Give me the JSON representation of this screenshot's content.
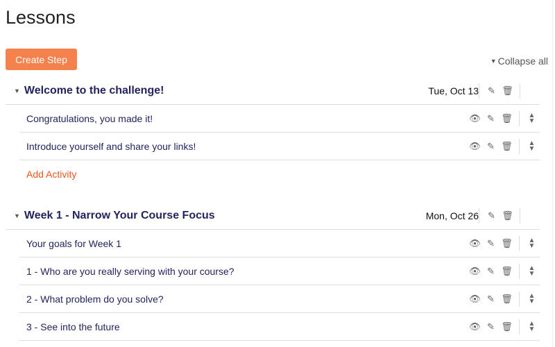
{
  "page": {
    "title": "Lessons",
    "create_label": "Create Step",
    "collapse_label": "Collapse all"
  },
  "sections": [
    {
      "title": "Welcome to the challenge!",
      "date": "Tue, Oct 13",
      "items": [
        "Congratulations, you made it!",
        "Introduce yourself and share your links!"
      ],
      "add_label": "Add Activity"
    },
    {
      "title": "Week 1 - Narrow Your Course Focus",
      "date": "Mon, Oct 26",
      "items": [
        "Your goals for Week 1",
        "1 - Who are you really serving with your course?",
        "2 - What problem do you solve?",
        "3 - See into the future"
      ]
    }
  ],
  "colors": {
    "accent": "#f5814d",
    "title": "#23235e",
    "link": "#e8541c"
  }
}
